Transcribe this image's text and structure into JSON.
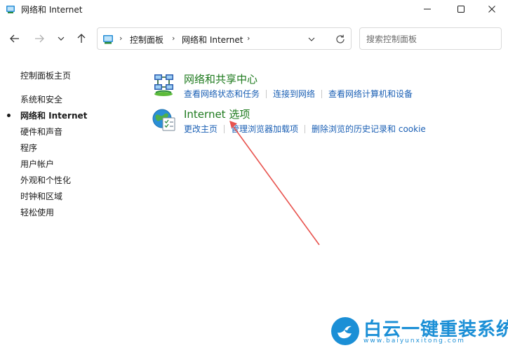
{
  "window": {
    "title": "网络和 Internet"
  },
  "colors": {
    "accent_green": "#1e7a1e",
    "link_blue": "#1a5fb4",
    "annotation_arrow": "#e8534e",
    "watermark_blue": "#1b8fd6"
  },
  "address": {
    "crumbs": [
      "控制面板",
      "网络和 Internet"
    ]
  },
  "search": {
    "placeholder": "搜索控制面板"
  },
  "sidebar": {
    "home": "控制面板主页",
    "items": [
      {
        "label": "系统和安全"
      },
      {
        "label": "网络和 Internet",
        "active": true
      },
      {
        "label": "硬件和声音"
      },
      {
        "label": "程序"
      },
      {
        "label": "用户帐户"
      },
      {
        "label": "外观和个性化"
      },
      {
        "label": "时钟和区域"
      },
      {
        "label": "轻松使用"
      }
    ]
  },
  "categories": [
    {
      "title": "网络和共享中心",
      "icon": "network-sharing-icon",
      "links": [
        "查看网络状态和任务",
        "连接到网络",
        "查看网络计算机和设备"
      ]
    },
    {
      "title": "Internet 选项",
      "icon": "internet-options-icon",
      "links": [
        "更改主页",
        "管理浏览器加载项",
        "删除浏览的历史记录和 cookie"
      ]
    }
  ],
  "watermark": {
    "brand": "白云一键重装系统",
    "url": "www.baiyunxitong.com"
  }
}
